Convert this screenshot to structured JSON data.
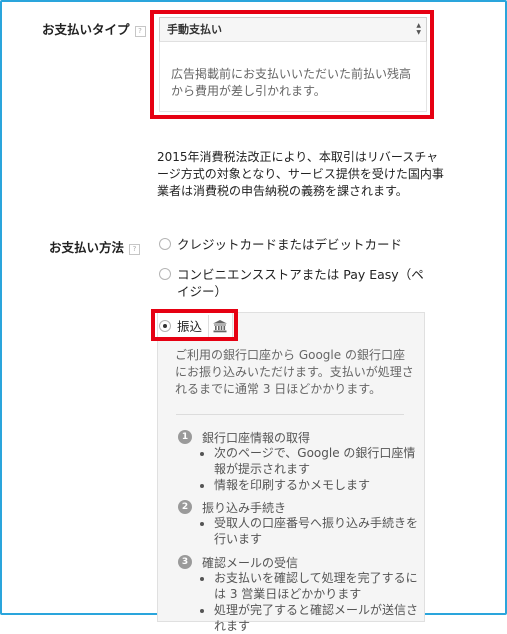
{
  "payment_type": {
    "label": "お支払いタイプ",
    "help": "?",
    "selected": "手動支払い",
    "description": "広告掲載前にお支払いいただいた前払い残高から費用が差し引かれます。"
  },
  "tax_notice": "2015年消費税法改正により、本取引はリバースチャージ方式の対象となり、サービス提供を受けた国内事業者は消費税の申告納税の義務を課されます。",
  "payment_method": {
    "label": "お支払い方法",
    "help": "?",
    "options": [
      {
        "label": "クレジットカードまたはデビットカード",
        "selected": false
      },
      {
        "label": "コンビニエンスストアまたは Pay Easy（ペイジー）",
        "selected": false
      },
      {
        "label": "振込",
        "selected": true
      }
    ]
  },
  "bank": {
    "info": "ご利用の銀行口座から Google の銀行口座にお振り込みいただけます。支払いが処理されるまでに通常 3 日ほどかかります。",
    "icon": "bank-icon",
    "steps": [
      {
        "num": "1",
        "title": "銀行口座情報の取得",
        "bullets": [
          "次のページで、Google の銀行口座情報が提示されます",
          "情報を印刷するかメモします"
        ]
      },
      {
        "num": "2",
        "title": "振り込み手続き",
        "bullets": [
          "受取人の口座番号へ振り込み手続きを行います"
        ]
      },
      {
        "num": "3",
        "title": "確認メールの受信",
        "bullets": [
          "お支払いを確認して処理を完了するには 3 営業日ほどかかります",
          "処理が完了すると確認メールが送信されます"
        ]
      }
    ]
  },
  "colors": {
    "highlight": "#e60012",
    "frame": "#2aa5dc"
  }
}
